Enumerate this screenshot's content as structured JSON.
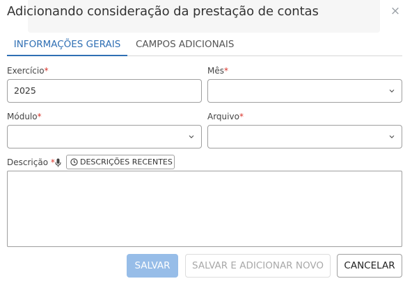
{
  "dialog": {
    "title": "Adicionando consideração da prestação de contas",
    "close_icon": "×"
  },
  "tabs": [
    {
      "label": "INFORMAÇÕES GERAIS",
      "active": true
    },
    {
      "label": "CAMPOS ADICIONAIS",
      "active": false
    }
  ],
  "form": {
    "exercicio": {
      "label": "Exercício",
      "required_mark": "*",
      "value": "2025"
    },
    "mes": {
      "label": "Mês",
      "required_mark": "*",
      "value": ""
    },
    "modulo": {
      "label": "Módulo",
      "required_mark": "*",
      "value": ""
    },
    "arquivo": {
      "label": "Arquivo",
      "required_mark": "*",
      "value": ""
    },
    "descricao": {
      "label": "Descrição",
      "required_mark": "*",
      "value": "",
      "recent_button": "DESCRIÇÕES RECENTES"
    }
  },
  "footer": {
    "save": "SALVAR",
    "save_new": "SALVAR E ADICIONAR NOVO",
    "cancel": "CANCELAR"
  },
  "colors": {
    "accent": "#2f6fb4",
    "required": "#d9342b",
    "save_disabled": "#97bde8"
  },
  "icons": [
    "close-icon",
    "chevron-down-icon",
    "microphone-icon",
    "clock-icon"
  ]
}
